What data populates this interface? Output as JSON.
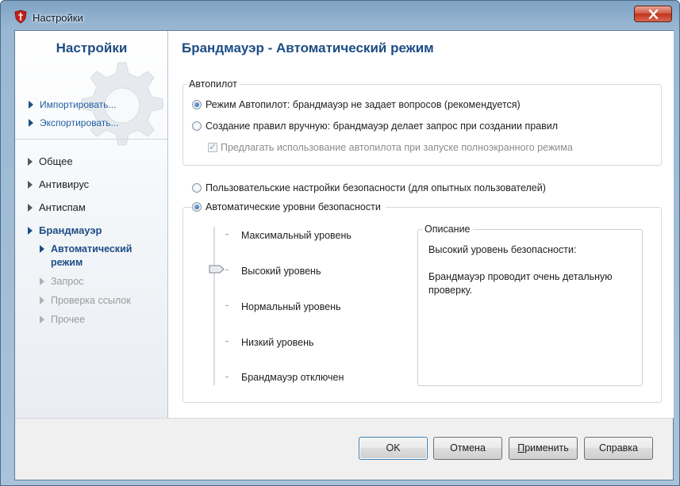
{
  "window": {
    "title": "Настройки"
  },
  "sidebar": {
    "title": "Настройки",
    "links": [
      {
        "label": "Импортировать..."
      },
      {
        "label": "Экспортировать..."
      }
    ],
    "nav": [
      {
        "label": "Общее"
      },
      {
        "label": "Антивирус"
      },
      {
        "label": "Антиспам"
      },
      {
        "label": "Брандмауэр"
      }
    ],
    "sub": [
      {
        "label": "Автоматический режим"
      },
      {
        "label": "Запрос"
      },
      {
        "label": "Проверка ссылок"
      },
      {
        "label": "Прочее"
      }
    ]
  },
  "main": {
    "title": "Брандмауэр - Автоматический режим",
    "autopilot": {
      "legend": "Автопилот",
      "option_auto": "Режим Автопилот: брандмауэр не задает вопросов (рекомендуется)",
      "option_manual": "Создание правил вручную: брандмауэр делает запрос при создании правил",
      "fullscreen_check": "Предлагать использование автопилота при запуске полноэкранного режима",
      "selected": "auto",
      "fullscreen_checked": true
    },
    "custom_settings": "Пользовательские настройки безопасности (для опытных пользователей)",
    "auto_levels": {
      "legend": "Автоматические уровни безопасности",
      "selected": true,
      "levels": [
        "Максимальный уровень",
        "Высокий уровень",
        "Нормальный уровень",
        "Низкий уровень",
        "Брандмауэр отключен"
      ],
      "current_level": "Высокий уровень"
    },
    "description": {
      "legend": "Описание",
      "line1": "Высокий уровень безопасности:",
      "line2": "Брандмауэр проводит очень детальную проверку."
    }
  },
  "buttons": {
    "ok": "OK",
    "cancel": "Отмена",
    "apply": "Применить",
    "help": "Справка"
  }
}
